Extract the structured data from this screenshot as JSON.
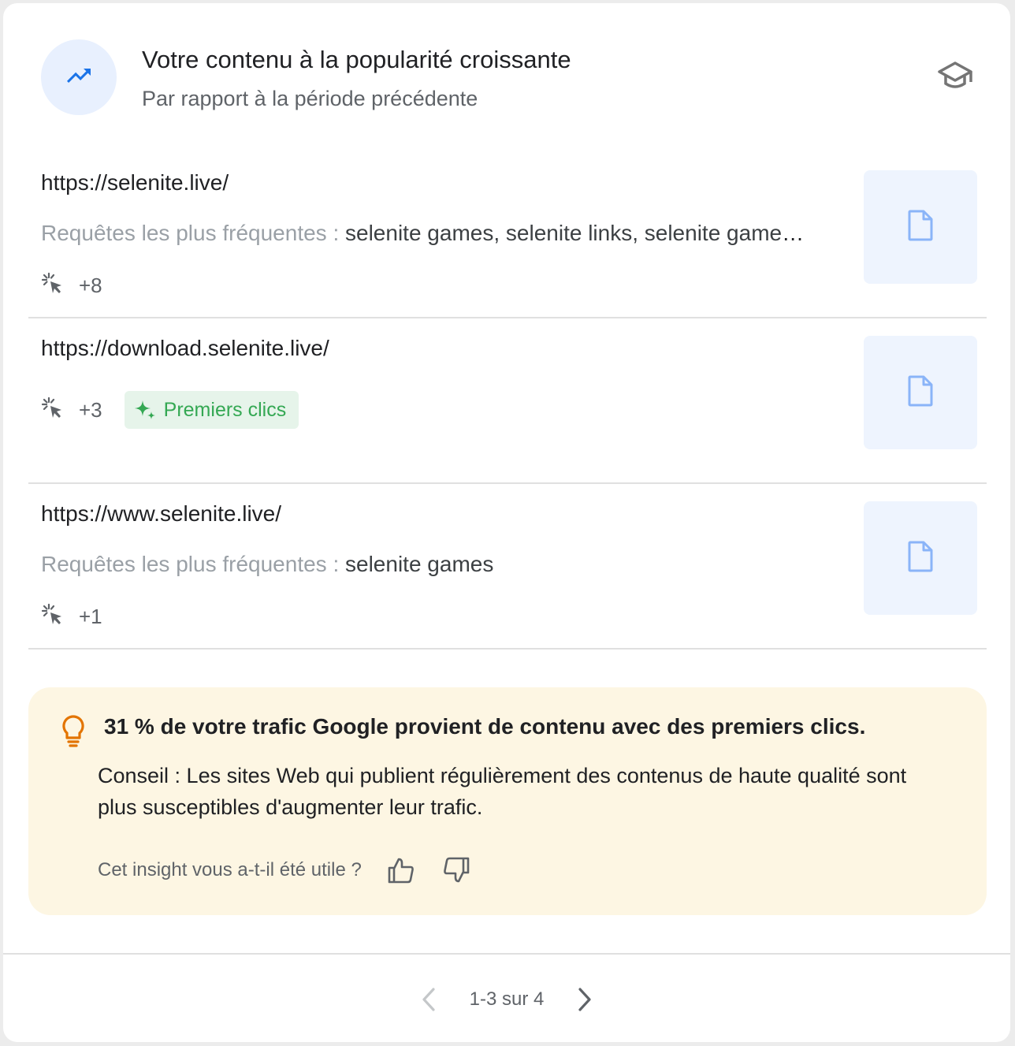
{
  "header": {
    "icon": "trending-up-icon",
    "title": "Votre contenu à la popularité croissante",
    "subtitle": "Par rapport à la période précédente",
    "learn_icon": "graduation-cap-icon"
  },
  "rows": [
    {
      "url": "https://selenite.live/",
      "queries_label": "Requêtes les plus fréquentes : ",
      "queries_value": "selenite games, selenite links, selenite games unblocked",
      "clicks": "+8",
      "badge": "",
      "thumbnail_icon": "document-icon"
    },
    {
      "url": "https://download.selenite.live/",
      "queries_label": "",
      "queries_value": "",
      "clicks": "+3",
      "badge": "Premiers clics",
      "badge_icon": "sparkle-icon",
      "thumbnail_icon": "document-icon"
    },
    {
      "url": "https://www.selenite.live/",
      "queries_label": "Requêtes les plus fréquentes : ",
      "queries_value": "selenite games",
      "clicks": "+1",
      "badge": "",
      "thumbnail_icon": "document-icon"
    }
  ],
  "insight": {
    "icon": "lightbulb-icon",
    "title": "31 % de votre trafic Google provient de contenu avec des premiers clics.",
    "tip": "Conseil : Les sites Web qui publient régulièrement des contenus de haute qualité sont plus susceptibles d'augmenter leur trafic.",
    "feedback_question": "Cet insight vous a-t-il été utile ?"
  },
  "pagination": {
    "text": "1-3 sur 4"
  },
  "colors": {
    "accent_blue": "#1a73e8",
    "badge_green": "#34a853",
    "insight_bg": "#fdf6e3",
    "bulb_orange": "#e37400"
  }
}
